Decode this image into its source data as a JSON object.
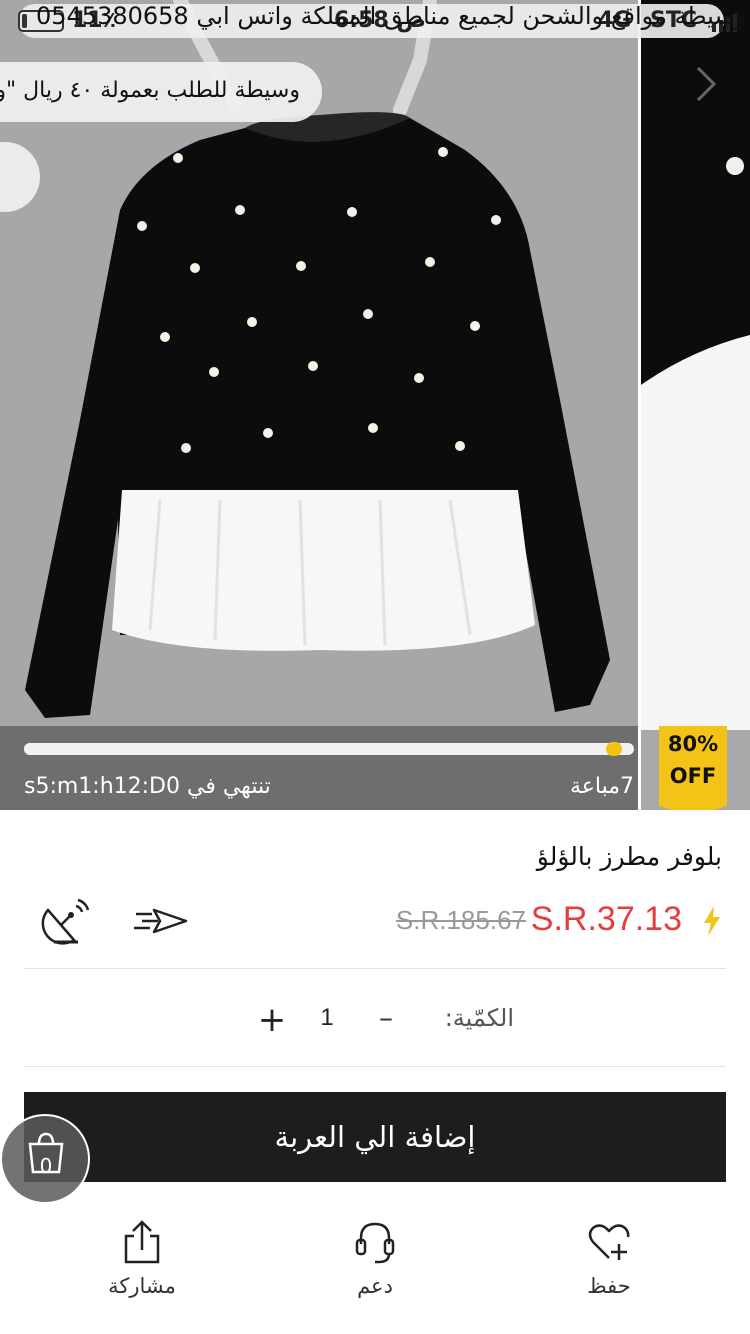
{
  "status_bar": {
    "carrier": "STC",
    "network": "4G",
    "time": "6:58 ص",
    "battery": "11٪",
    "marquee": "وسيطة مواقع والشحن لجميع مناطق المملكة واتس ابي 0545380658"
  },
  "promo_banner": "وسيطة للطلب بعمولة ٤٠ ريال \"و",
  "flash_sale": {
    "progress": 0.98,
    "countdown": "تنتهي في s5:m1:h12:D0",
    "sold": "7مباعة",
    "discount_top": "80%",
    "discount_bottom": "OFF"
  },
  "product": {
    "title": "بلوفر مطرز بالؤلؤ",
    "price": "S.R.37.13",
    "original_price": "S.R.185.67"
  },
  "quantity": {
    "label": "الكمّية:",
    "value": "1",
    "minus": "–",
    "plus": "+"
  },
  "cart": {
    "add_button": "إضافة الي العربة",
    "count": "0"
  },
  "toolbar": {
    "share": "مشاركة",
    "support": "دعم",
    "save": "حفظ"
  },
  "colors": {
    "price": "#e43d3d",
    "badge": "#f3c318",
    "button": "#1d1d1d"
  }
}
